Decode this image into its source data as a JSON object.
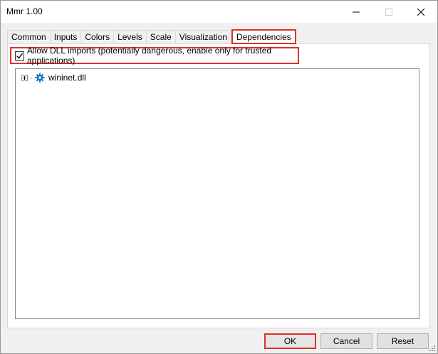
{
  "window": {
    "title": "Mmr 1.00"
  },
  "tabs": [
    {
      "label": "Common",
      "active": false
    },
    {
      "label": "Inputs",
      "active": false
    },
    {
      "label": "Colors",
      "active": false
    },
    {
      "label": "Levels",
      "active": false
    },
    {
      "label": "Scale",
      "active": false
    },
    {
      "label": "Visualization",
      "active": false
    },
    {
      "label": "Dependencies",
      "active": true
    }
  ],
  "dependencies": {
    "allow_dll_label": "Allow DLL imports (potentially dangerous, enable only for trusted applications)",
    "allow_dll_checked": true,
    "tree_items": [
      {
        "label": "wininet.dll",
        "icon": "gear-icon",
        "expanded": false
      }
    ]
  },
  "buttons": {
    "ok": "OK",
    "cancel": "Cancel",
    "reset": "Reset"
  },
  "colors": {
    "highlight": "#e0302a",
    "gear": "#1e6fbf"
  }
}
